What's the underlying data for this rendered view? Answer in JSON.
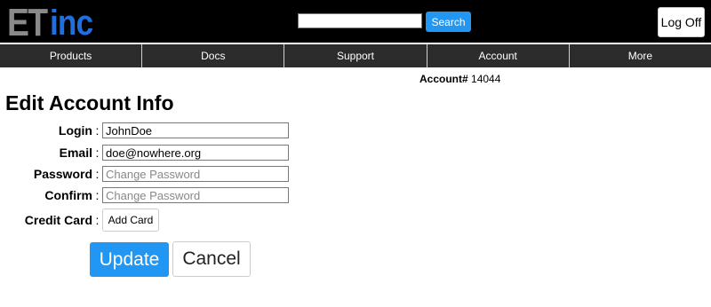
{
  "header": {
    "logo_prefix": "ET",
    "logo_suffix": "inc",
    "search": {
      "value": "",
      "placeholder": ""
    },
    "search_button": "Search",
    "logoff_button": "Log Off"
  },
  "nav": {
    "items": [
      "Products",
      "Docs",
      "Support",
      "Account",
      "More"
    ]
  },
  "account": {
    "label": "Account#",
    "number": "14044"
  },
  "page_title": "Edit Account Info",
  "form": {
    "colon": ":",
    "login": {
      "label": "Login",
      "value": "JohnDoe"
    },
    "email": {
      "label": "Email",
      "value": "doe@nowhere.org"
    },
    "password": {
      "label": "Password",
      "placeholder": "Change Password"
    },
    "confirm": {
      "label": "Confirm",
      "placeholder": "Change Password"
    },
    "credit_card": {
      "label": "Credit Card",
      "button": "Add Card"
    },
    "update_button": "Update",
    "cancel_button": "Cancel"
  },
  "colors": {
    "header_bg": "#000000",
    "nav_bg": "#2c2c2c",
    "accent": "#2196f3",
    "logo_et": "#8a8a8a",
    "logo_inc": "#1e6fe0"
  }
}
